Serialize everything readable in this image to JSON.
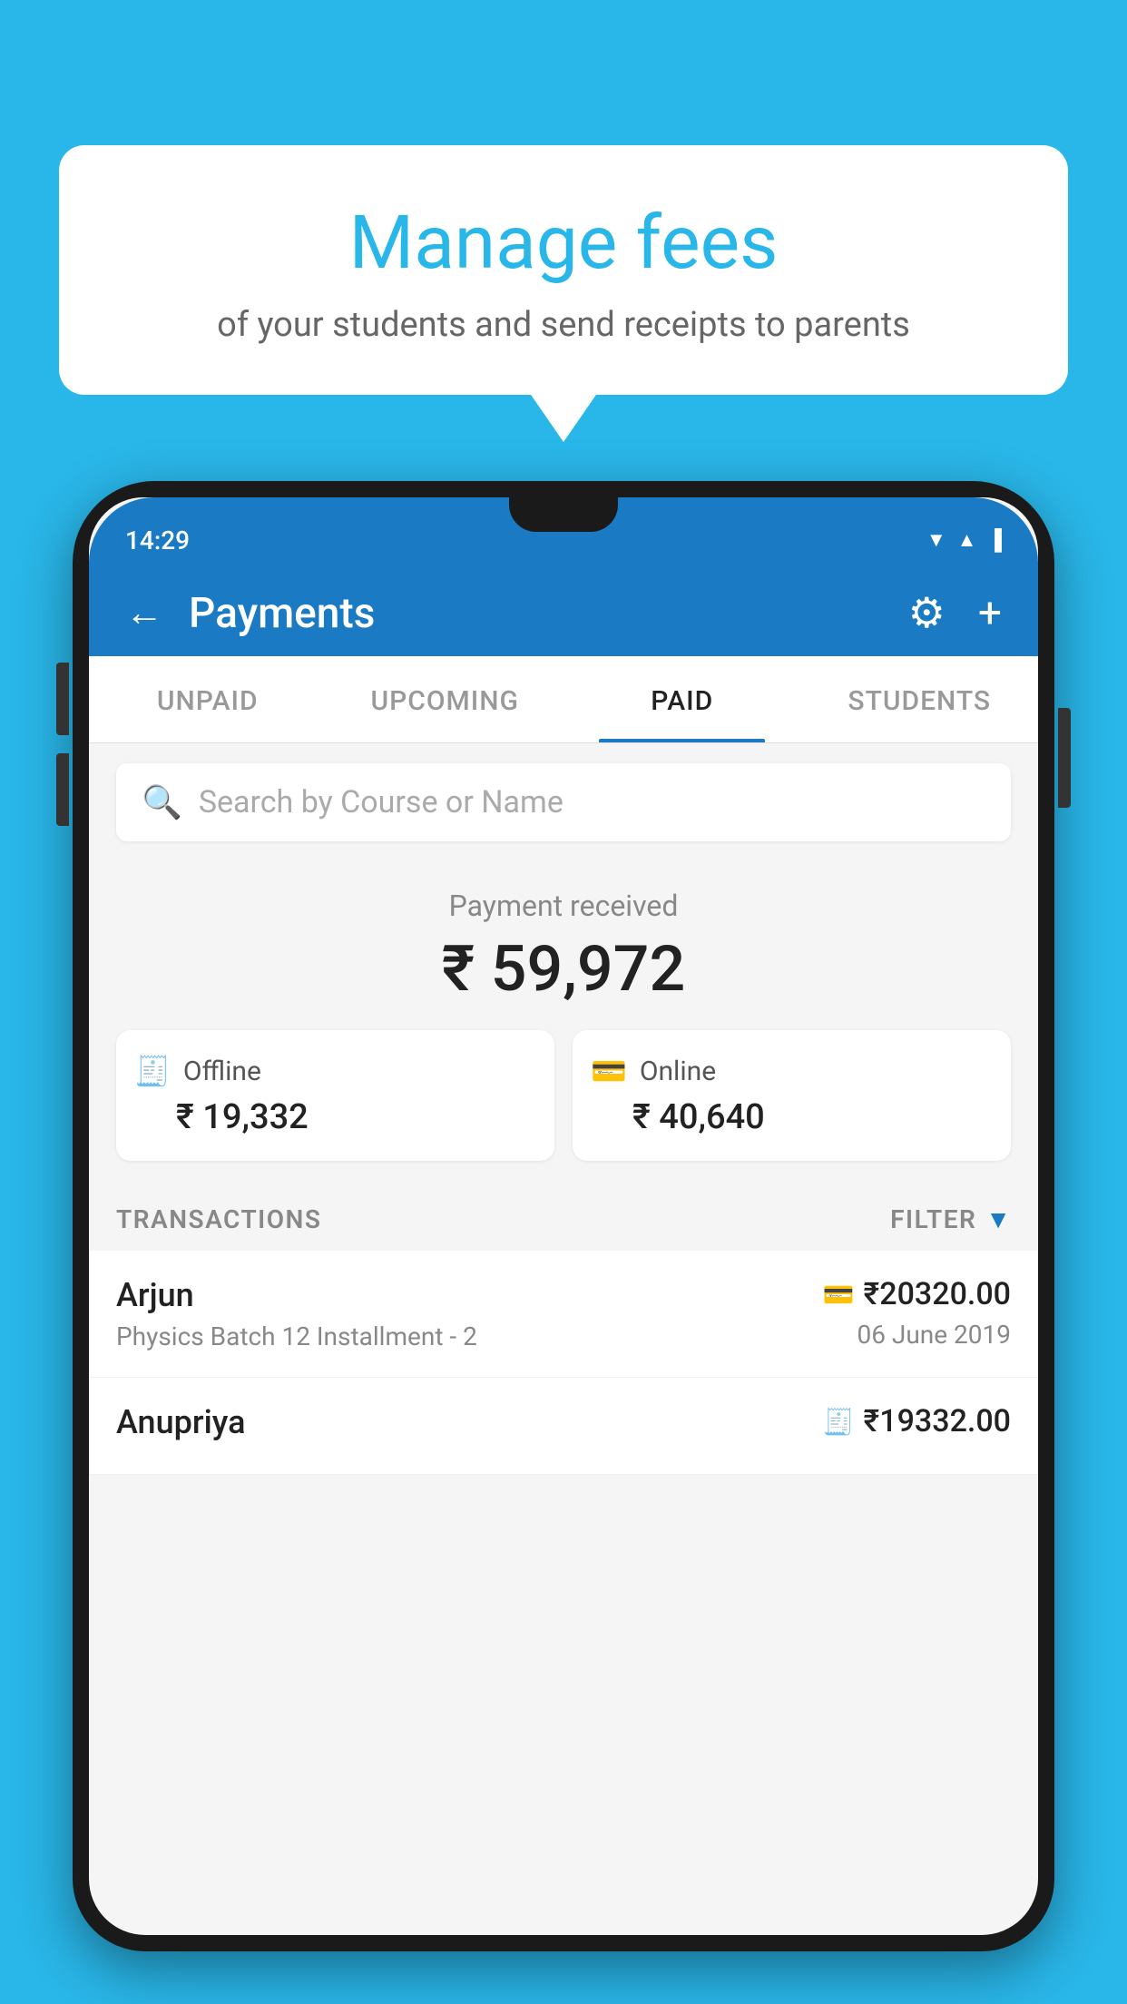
{
  "background_color": "#29b6e8",
  "bubble": {
    "title": "Manage fees",
    "subtitle": "of your students and send receipts to parents"
  },
  "status_bar": {
    "time": "14:29",
    "icons": [
      "▲",
      "▲",
      "▐"
    ]
  },
  "header": {
    "title": "Payments",
    "back_label": "←",
    "settings_label": "⚙",
    "add_label": "+"
  },
  "tabs": [
    {
      "label": "UNPAID",
      "active": false
    },
    {
      "label": "UPCOMING",
      "active": false
    },
    {
      "label": "PAID",
      "active": true
    },
    {
      "label": "STUDENTS",
      "active": false
    }
  ],
  "search": {
    "placeholder": "Search by Course or Name"
  },
  "payment_summary": {
    "received_label": "Payment received",
    "total_amount": "₹ 59,972",
    "offline": {
      "icon": "💳",
      "label": "Offline",
      "amount": "₹ 19,332"
    },
    "online": {
      "icon": "💳",
      "label": "Online",
      "amount": "₹ 40,640"
    }
  },
  "transactions": {
    "section_label": "TRANSACTIONS",
    "filter_label": "FILTER",
    "rows": [
      {
        "name": "Arjun",
        "course": "Physics Batch 12 Installment - 2",
        "amount": "₹20320.00",
        "date": "06 June 2019",
        "payment_type": "online"
      },
      {
        "name": "Anupriya",
        "course": "",
        "amount": "₹19332.00",
        "date": "",
        "payment_type": "offline"
      }
    ]
  }
}
